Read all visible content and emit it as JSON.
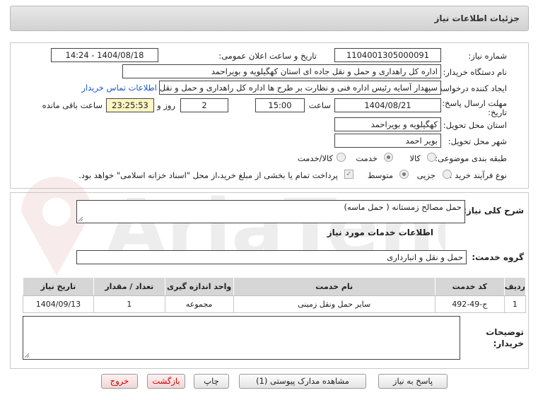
{
  "header": {
    "title": "جزئیات اطلاعات نیاز"
  },
  "form": {
    "need_number_label": "شماره نیاز:",
    "need_number": "1104001305000091",
    "announce_label": "تاریخ و ساعت اعلان عمومی:",
    "announce_value": "1404/08/18 - 14:24",
    "buyer_org_label": "نام دستگاه خریدار:",
    "buyer_org": "اداره کل راهداری و حمل و نقل جاده ای استان کهگیلویه و بویراحمد",
    "creator_label": "ایجاد کننده درخواست:",
    "creator": "سپهدار آسایه رئیس اداره فنی و نظارت بر طرح ها اداره کل راهداری و حمل و نقل",
    "contact_link": "اطلاعات تماس خریدار",
    "deadline_label_1": "مهلت ارسال پاسخ: تا",
    "deadline_label_2": "تاریخ:",
    "deadline_date": "1404/08/21",
    "time_label": "ساعت",
    "deadline_time": "15:00",
    "days_value": "2",
    "days_label": "روز و",
    "remaining_time": "23:25:53",
    "remaining_label": "ساعت باقی مانده",
    "province_label": "استان محل تحویل:",
    "province": "کهگیلویه و بویراحمد",
    "city_label": "شهر محل تحویل:",
    "city": "بویر احمد",
    "category_label": "طبقه بندی موضوعی:",
    "category_options": [
      "کالا",
      "خدمت",
      "کالا/خدمت"
    ],
    "category_selected": "خدمت",
    "purchase_type_label": "نوع فرآیند خرید :",
    "purchase_options": [
      "جزیی",
      "متوسط"
    ],
    "purchase_selected": "متوسط",
    "payment_note": "پرداخت تمام یا بخشی از مبلغ خرید،از محل \"اسناد خزانه اسلامی\" خواهد بود."
  },
  "summary": {
    "label": "شرح کلی نیاز:",
    "value": "حمل مصالح زمستانه ( حمل ماسه)"
  },
  "services": {
    "section_title": "اطلاعات خدمات مورد نیاز",
    "group_label": "گروه خدمت:",
    "group_value": "حمل و نقل و انبارداری",
    "columns": [
      "ردیف",
      "کد خدمت",
      "نام خدمت",
      "واحد اندازه گیری",
      "تعداد / مقدار",
      "تاریخ نیاز"
    ],
    "rows": [
      [
        "1",
        "ج-49-492",
        "سایر حمل ونقل زمینی",
        "مجموعه",
        "1",
        "1404/09/13"
      ]
    ]
  },
  "notes": {
    "label_1": "توضیحات",
    "label_2": "خریدار:"
  },
  "buttons": {
    "reply": "پاسخ به نیاز",
    "attachments": "مشاهده مدارک پیوستی (1)",
    "print": "چاپ",
    "back": "بازگشت",
    "exit": "خروج"
  },
  "colors": {
    "link": "#1a56c8",
    "remaining_bg": "#fdf5c2",
    "header_bg": "#d8d8d8",
    "exit_text": "#cc0000"
  }
}
